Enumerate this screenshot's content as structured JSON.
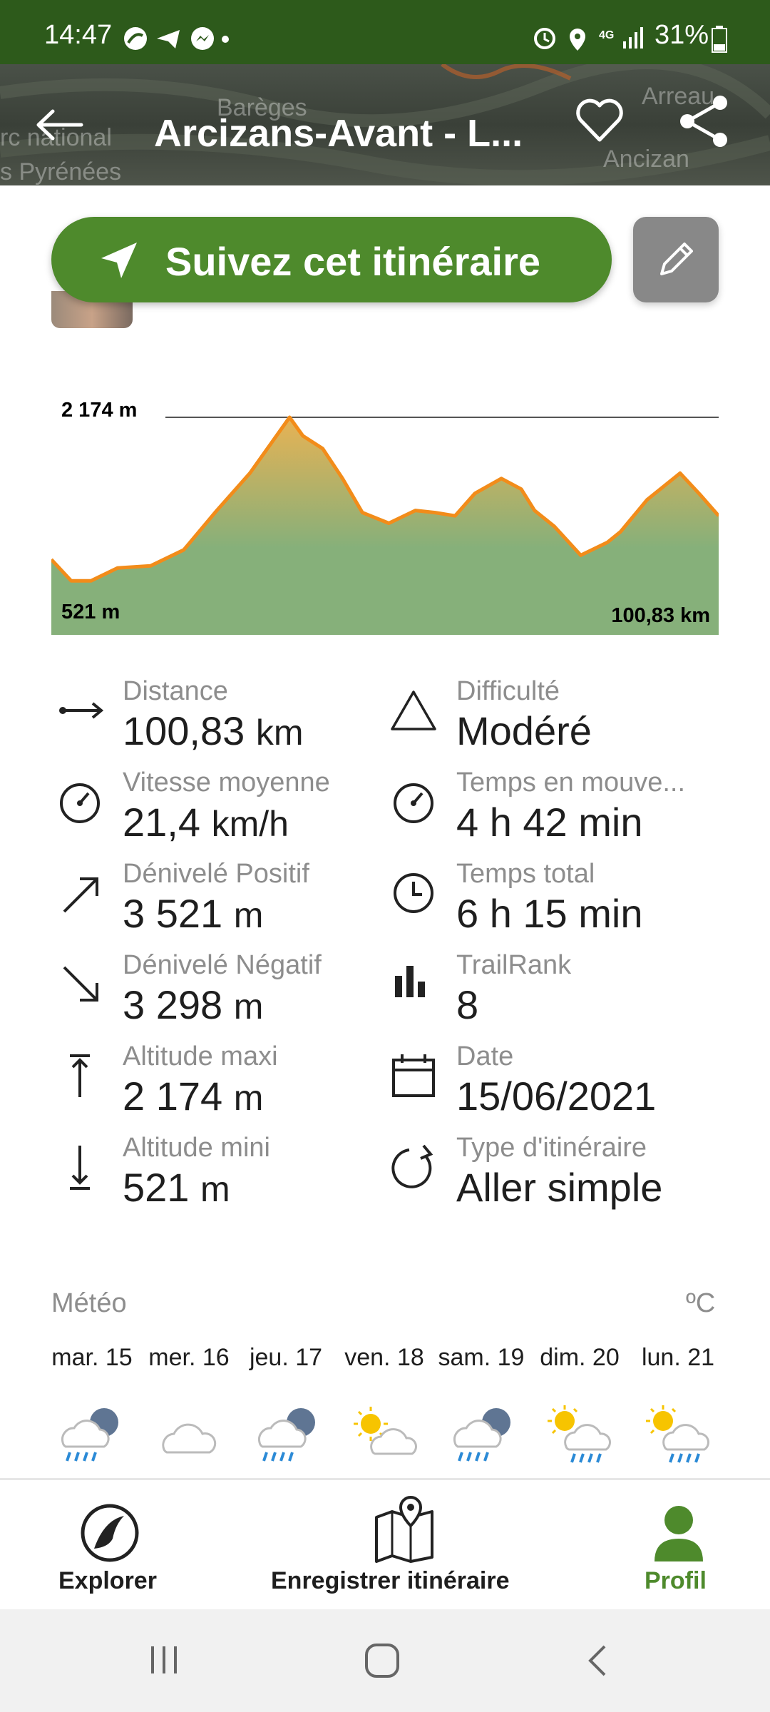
{
  "status_bar": {
    "time": "14:47",
    "battery": "31%",
    "network": "4G"
  },
  "header": {
    "title": "Arcizans-Avant - L...",
    "map_labels": [
      "Barèges",
      "rc national",
      "s Pyrénées",
      "Arreau",
      "Ancizan"
    ]
  },
  "follow_button": {
    "label": "Suivez cet itinéraire"
  },
  "chart_data": {
    "type": "area",
    "max_label": "2 174 m",
    "min_label": "521 m",
    "distance_label": "100,83 km",
    "x": [
      0,
      3,
      6,
      10,
      15,
      20,
      25,
      30,
      36,
      38,
      41,
      44,
      47,
      51,
      55,
      58,
      61,
      64,
      68,
      71,
      73,
      76,
      80,
      84,
      86,
      90,
      95,
      98,
      100.83
    ],
    "y": [
      840,
      640,
      640,
      760,
      780,
      930,
      1300,
      1650,
      2174,
      2000,
      1880,
      1600,
      1280,
      1180,
      1300,
      1280,
      1250,
      1460,
      1600,
      1500,
      1300,
      1150,
      880,
      1000,
      1100,
      1400,
      1650,
      1450,
      1250
    ],
    "ylim": [
      521,
      2174
    ],
    "colors": {
      "line": "#f28c1a",
      "fill_top": "#e8b254",
      "fill_bottom": "#86b07a"
    }
  },
  "stats": {
    "left": [
      {
        "label": "Distance",
        "value": "100,83",
        "unit": "km",
        "icon": "distance-arrow-icon"
      },
      {
        "label": "Vitesse moyenne",
        "value": "21,4",
        "unit": "km/h",
        "icon": "speedometer-icon"
      },
      {
        "label": "Dénivelé Positif",
        "value": "3 521",
        "unit": "m",
        "icon": "arrow-up-right-icon"
      },
      {
        "label": "Dénivelé Négatif",
        "value": "3 298",
        "unit": "m",
        "icon": "arrow-down-right-icon"
      },
      {
        "label": "Altitude maxi",
        "value": "2 174",
        "unit": "m",
        "icon": "arrow-up-to-bar-icon"
      },
      {
        "label": "Altitude mini",
        "value": "521",
        "unit": "m",
        "icon": "arrow-down-to-bar-icon"
      }
    ],
    "right": [
      {
        "label": "Difficulté",
        "value": "Modéré",
        "icon": "triangle-icon"
      },
      {
        "label": "Temps en mouve...",
        "value": "4 h 42 min",
        "icon": "speedometer-icon"
      },
      {
        "label": "Temps total",
        "value": "6 h 15 min",
        "icon": "clock-icon"
      },
      {
        "label": "TrailRank",
        "value": "8",
        "icon": "bar-chart-icon"
      },
      {
        "label": "Date",
        "value": "15/06/2021",
        "icon": "calendar-icon"
      },
      {
        "label": "Type d'itinéraire",
        "value": "Aller simple",
        "icon": "loop-arrow-icon"
      }
    ]
  },
  "weather": {
    "title": "Météo",
    "unit": "ºC",
    "days": [
      {
        "label": "mar. 15",
        "icon": "rain-cloud-icon"
      },
      {
        "label": "mer. 16",
        "icon": "cloud-icon"
      },
      {
        "label": "jeu. 17",
        "icon": "rain-cloud-icon"
      },
      {
        "label": "ven. 18",
        "icon": "sun-cloud-icon"
      },
      {
        "label": "sam. 19",
        "icon": "rain-cloud-icon"
      },
      {
        "label": "dim. 20",
        "icon": "sun-rain-icon"
      },
      {
        "label": "lun. 21",
        "icon": "sun-rain-icon"
      }
    ]
  },
  "bottom_nav": {
    "items": [
      {
        "label": "Explorer",
        "active": false
      },
      {
        "label": "Enregistrer itinéraire",
        "active": false
      },
      {
        "label": "Profil",
        "active": true
      }
    ],
    "active_color": "#4e8a2c"
  }
}
